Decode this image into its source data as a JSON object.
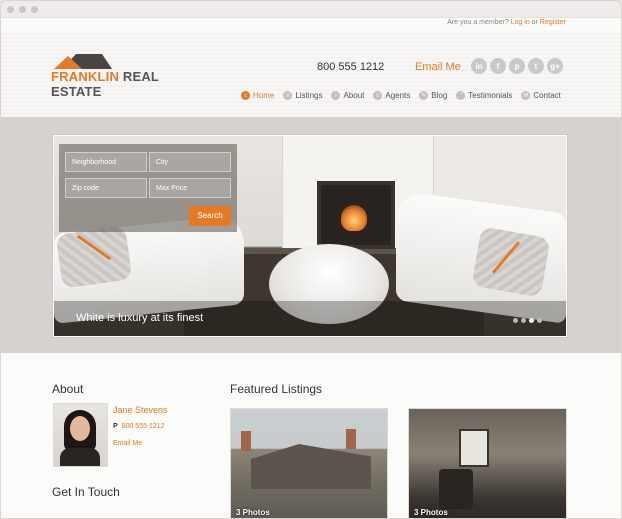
{
  "topbar": {
    "prompt": "Are you a member?",
    "login": "Log in",
    "or": "or",
    "register": "Register"
  },
  "brand": {
    "name_part1": "FRANKLIN",
    "name_part2": "REAL ESTATE",
    "accent": "#e57a26"
  },
  "header": {
    "phone": "800 555 1212",
    "email_link": "Email Me"
  },
  "socials": [
    {
      "icon": "linkedin-icon",
      "glyph": "in"
    },
    {
      "icon": "facebook-icon",
      "glyph": "f"
    },
    {
      "icon": "pinterest-icon",
      "glyph": "p"
    },
    {
      "icon": "twitter-icon",
      "glyph": "t"
    },
    {
      "icon": "googleplus-icon",
      "glyph": "g+"
    }
  ],
  "nav": [
    {
      "label": "Home",
      "icon": "home-icon",
      "active": true
    },
    {
      "label": "Listings",
      "icon": "listings-icon",
      "active": false
    },
    {
      "label": "About",
      "icon": "about-icon",
      "active": false
    },
    {
      "label": "Agents",
      "icon": "agents-icon",
      "active": false
    },
    {
      "label": "Blog",
      "icon": "blog-icon",
      "active": false
    },
    {
      "label": "Testimonials",
      "icon": "testimonials-icon",
      "active": false
    },
    {
      "label": "Contact",
      "icon": "contact-icon",
      "active": false
    }
  ],
  "search": {
    "neighborhood_placeholder": "Neighborhood",
    "city_placeholder": "City",
    "zip_placeholder": "Zip code",
    "max_price_placeholder": "Max Price",
    "button": "Search"
  },
  "slider": {
    "caption": "White is luxury at its finest",
    "slide_count": 4,
    "active_slide": 3
  },
  "about": {
    "title": "About",
    "agent_name": "Jane Stevens",
    "phone_prefix": "P",
    "phone": "800 555 1212",
    "email": "Email Me"
  },
  "get_in_touch": {
    "title": "Get In Touch"
  },
  "featured": {
    "title": "Featured Listings",
    "listings": [
      {
        "photos": "3 Photos"
      },
      {
        "photos": "3 Photos"
      }
    ]
  }
}
